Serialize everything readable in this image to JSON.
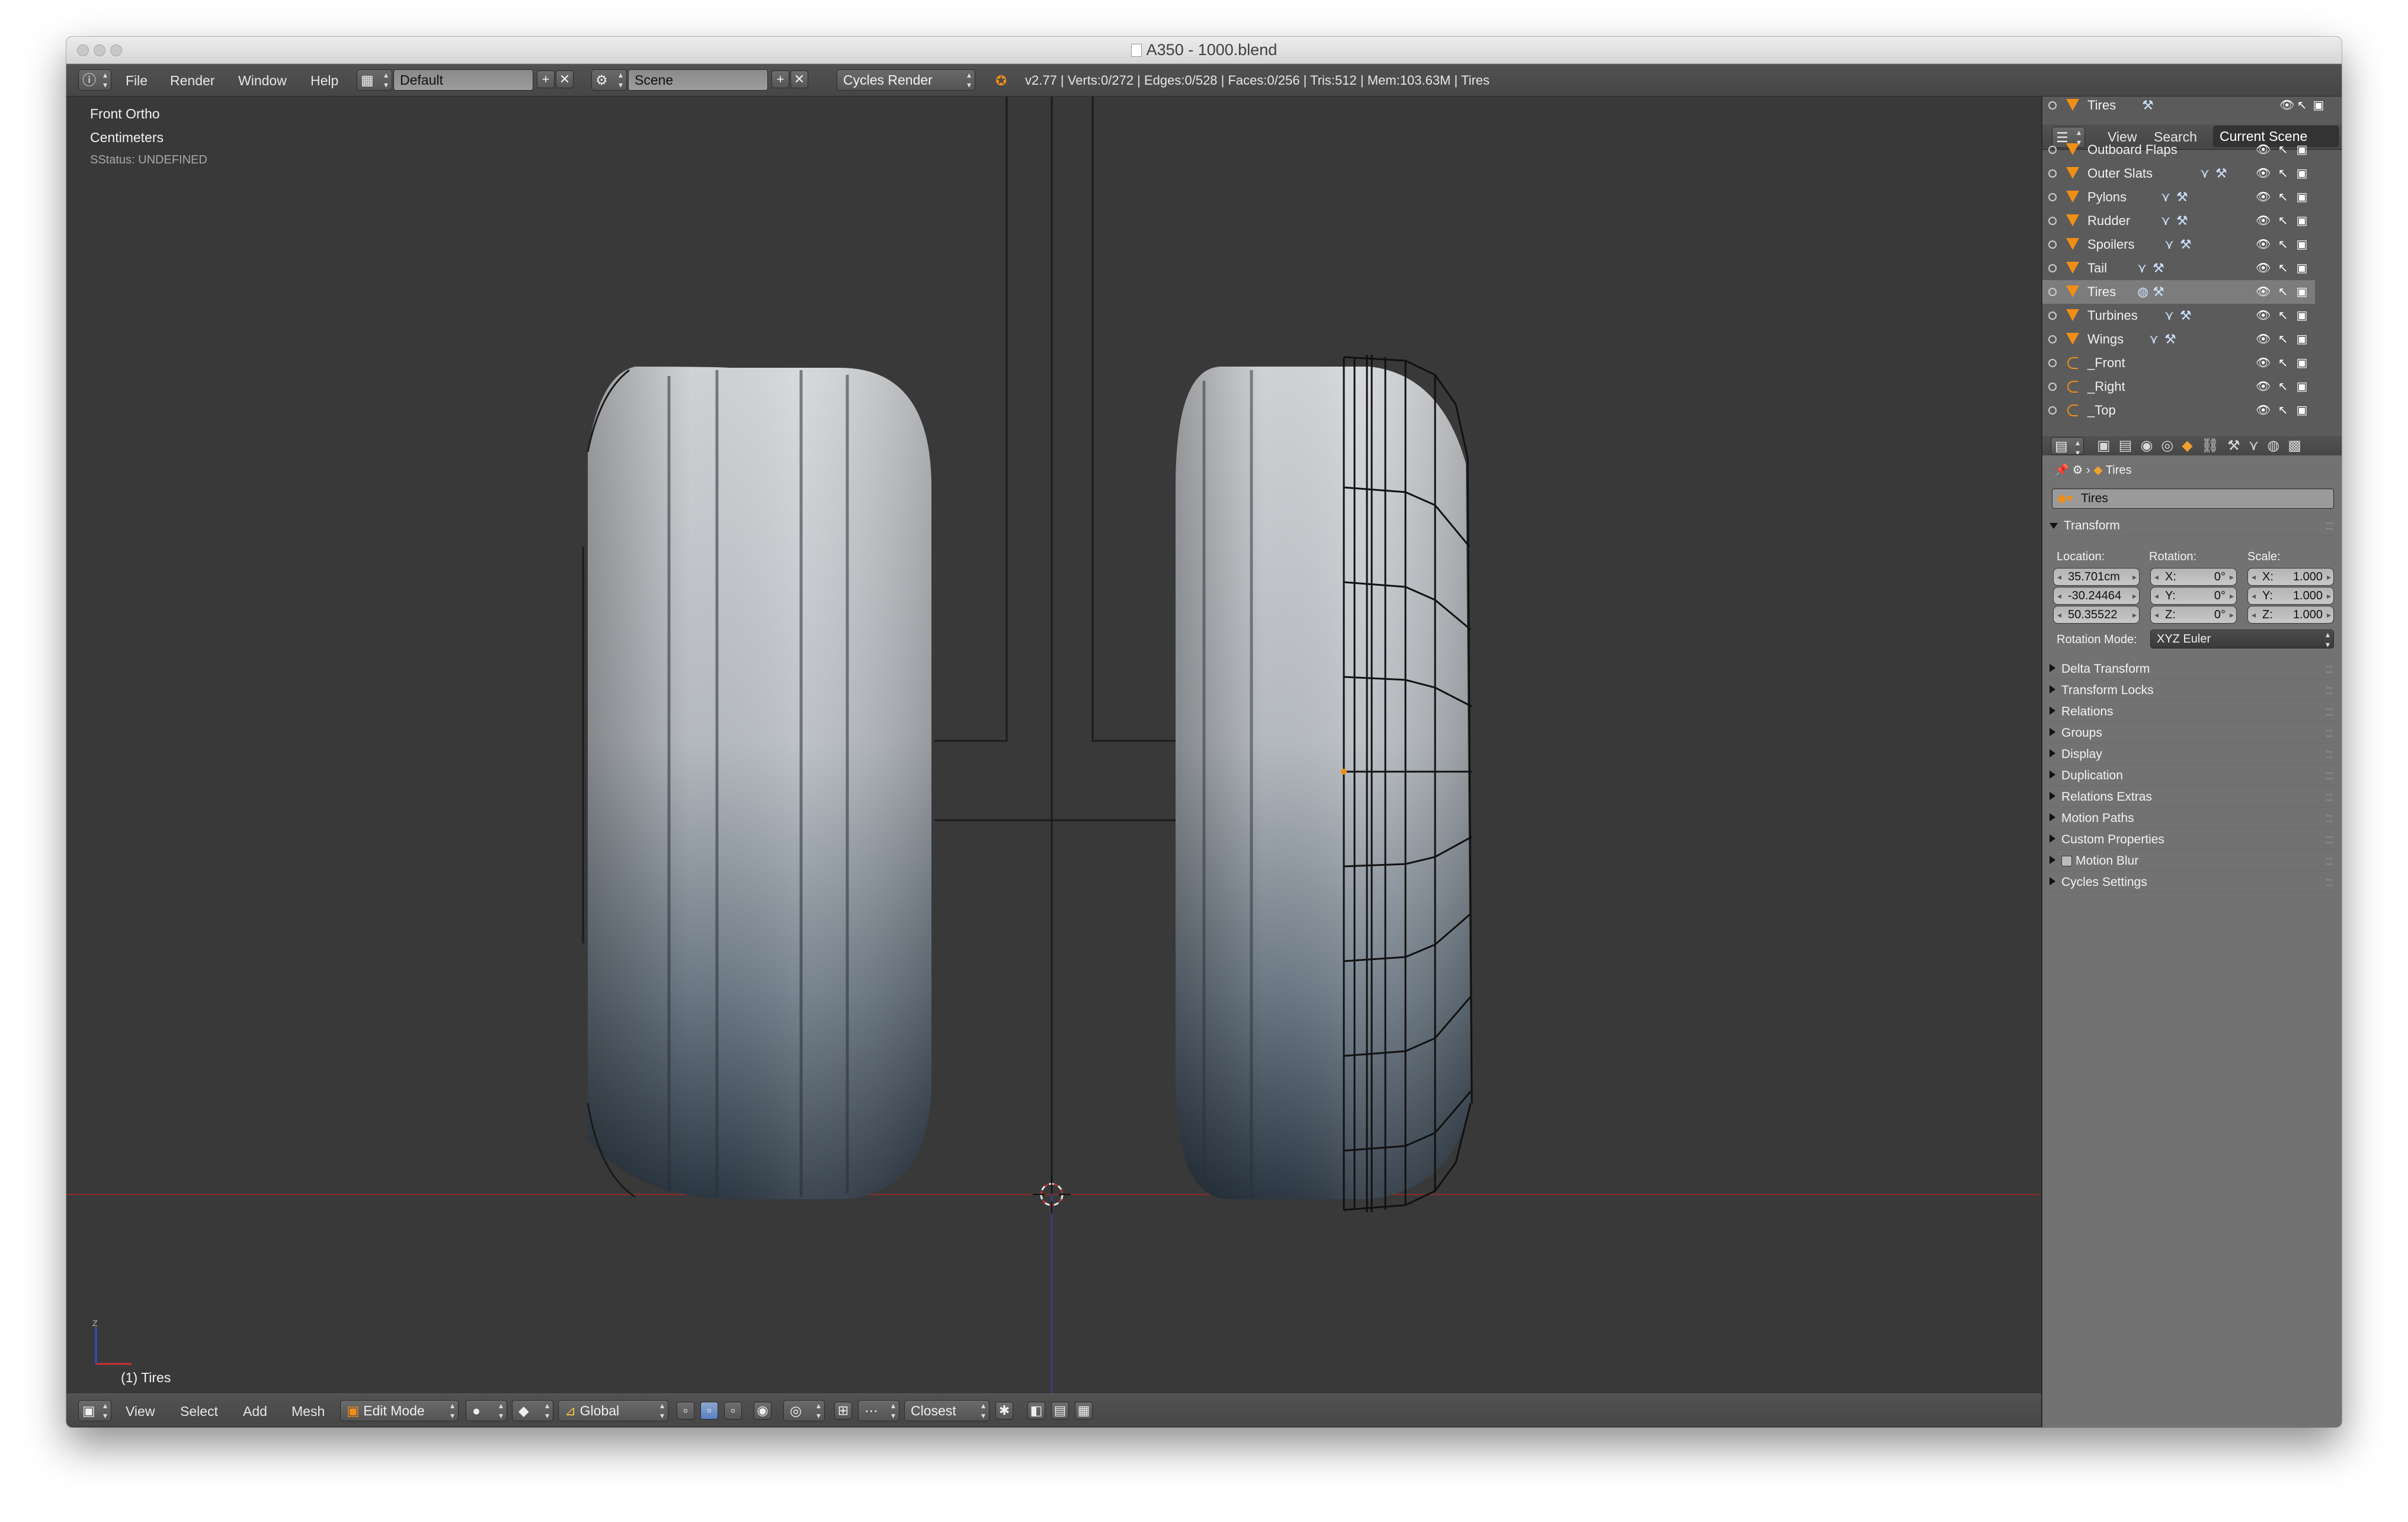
{
  "window": {
    "title": "A350 - 1000.blend"
  },
  "info_header": {
    "menus": [
      "File",
      "Render",
      "Window",
      "Help"
    ],
    "screen_layout": "Default",
    "scene": "Scene",
    "render_engine": "Cycles Render",
    "stats": "v2.77 | Verts:0/272 | Edges:0/528 | Faces:0/256 | Tris:512 | Mem:103.63M | Tires"
  },
  "viewport": {
    "view_name": "Front Ortho",
    "units": "Centimeters",
    "status": "SStatus: UNDEFINED",
    "active_object": "(1) Tires",
    "colors": {
      "background": "#393939",
      "x_axis": "#8a2c2c",
      "z_axis": "#3c3c8c"
    }
  },
  "view3d_header": {
    "menus": [
      "View",
      "Select",
      "Add",
      "Mesh"
    ],
    "mode": "Edit Mode",
    "orientation": "Global",
    "snap_target": "Closest"
  },
  "outliner": {
    "header_object": "Tires",
    "tabs": [
      "View",
      "Search",
      "Current Scene"
    ],
    "items": [
      {
        "name": "Outboard Flaps",
        "icon": "mesh-icon"
      },
      {
        "name": "Outer Slats",
        "icon": "mesh-icon"
      },
      {
        "name": "Pylons",
        "icon": "mesh-icon"
      },
      {
        "name": "Rudder",
        "icon": "mesh-icon"
      },
      {
        "name": "Spoilers",
        "icon": "mesh-icon"
      },
      {
        "name": "Tail",
        "icon": "mesh-icon"
      },
      {
        "name": "Tires",
        "icon": "mesh-icon",
        "selected": true
      },
      {
        "name": "Turbines",
        "icon": "mesh-icon"
      },
      {
        "name": "Wings",
        "icon": "mesh-icon"
      },
      {
        "name": "_Front",
        "icon": "camera-icon"
      },
      {
        "name": "_Right",
        "icon": "camera-icon"
      },
      {
        "name": "_Top",
        "icon": "camera-icon"
      }
    ]
  },
  "properties": {
    "breadcrumb_object": "Tires",
    "object_name": "Tires",
    "transform_label": "Transform",
    "location_label": "Location:",
    "rotation_label": "Rotation:",
    "scale_label": "Scale:",
    "location": [
      "35.701cm",
      "-30.24464",
      "50.35522"
    ],
    "rotation": [
      {
        "axis": "X:",
        "value": "0°"
      },
      {
        "axis": "Y:",
        "value": "0°"
      },
      {
        "axis": "Z:",
        "value": "0°"
      }
    ],
    "scale": [
      {
        "axis": "X:",
        "value": "1.000"
      },
      {
        "axis": "Y:",
        "value": "1.000"
      },
      {
        "axis": "Z:",
        "value": "1.000"
      }
    ],
    "rotation_mode_label": "Rotation Mode:",
    "rotation_mode": "XYZ Euler",
    "panels": [
      "Delta Transform",
      "Transform Locks",
      "Relations",
      "Groups",
      "Display",
      "Duplication",
      "Relations Extras",
      "Motion Paths",
      "Custom Properties",
      "Motion Blur",
      "Cycles Settings"
    ]
  },
  "colors": {
    "accent": "#5680c2",
    "object_orange": "#f08e17",
    "panel_bg": "#727272",
    "header_bg": "#4c4c4c"
  }
}
